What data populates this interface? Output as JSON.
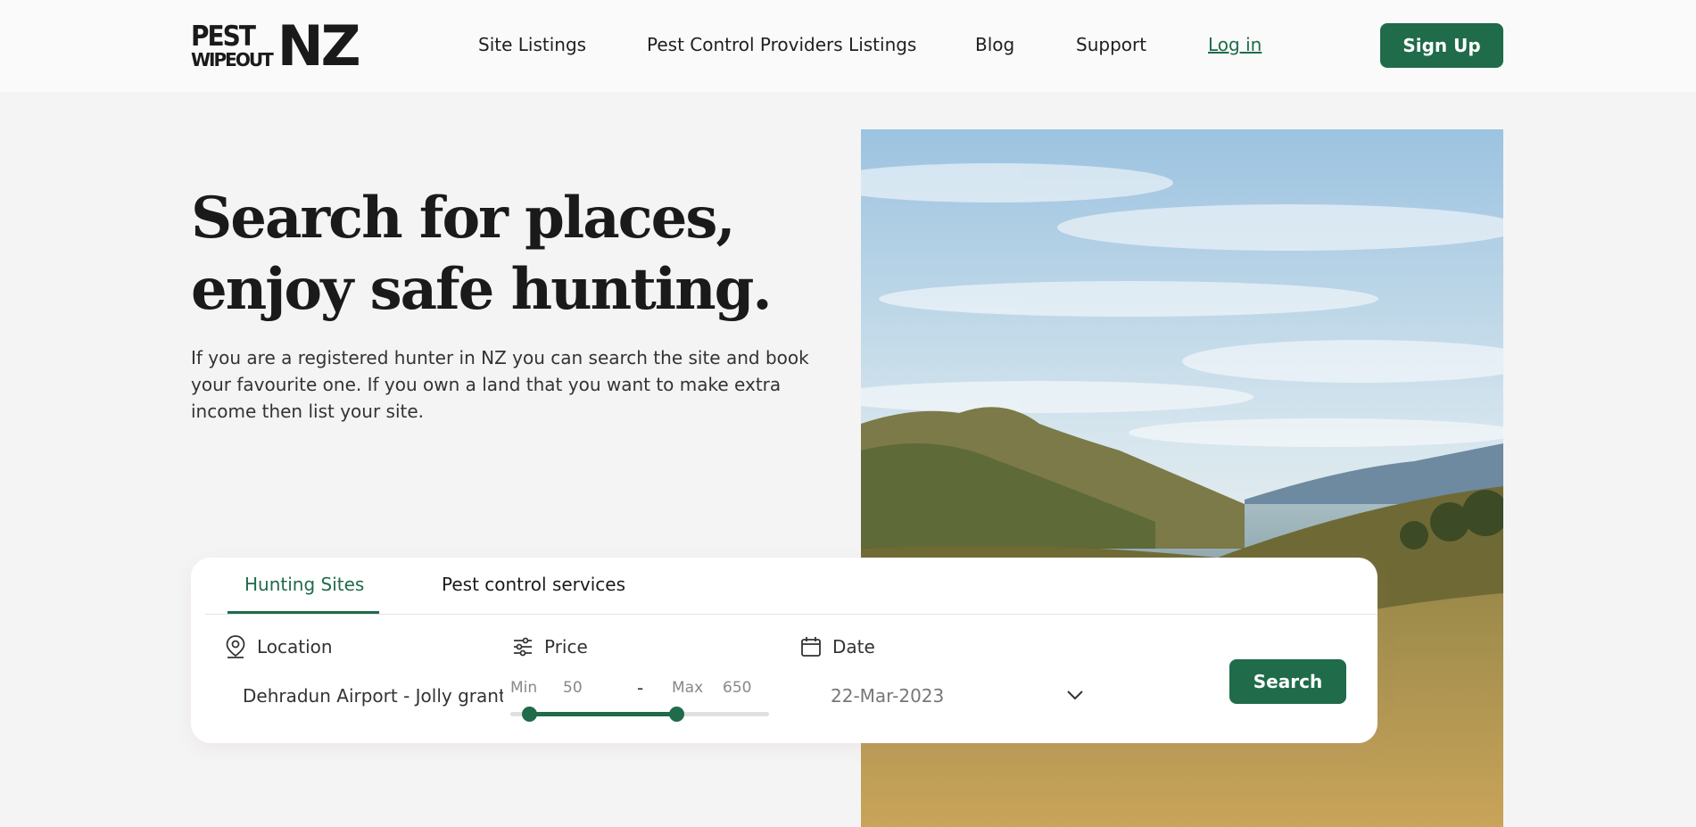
{
  "brand": {
    "logo_top": "PEST",
    "logo_bottom": "WIPEOUT",
    "logo_main": "NZ",
    "accent": "#1f6b4a"
  },
  "nav": {
    "items": [
      {
        "label": "Site Listings"
      },
      {
        "label": "Pest Control Providers Listings"
      },
      {
        "label": "Blog"
      },
      {
        "label": "Support"
      },
      {
        "label": "Log in"
      }
    ],
    "signup_label": "Sign Up"
  },
  "hero": {
    "title": "Search for places, enjoy safe hunting.",
    "description": "If you are a registered hunter in NZ you can search the site and book your favourite one. If you own a land that you want to make extra income then list your site."
  },
  "search": {
    "tabs": [
      {
        "label": "Hunting Sites",
        "active": true
      },
      {
        "label": "Pest control services",
        "active": false
      }
    ],
    "location": {
      "label": "Location",
      "icon": "map-pin-icon",
      "value": "Dehradun Airport - Jolly grant, Uttarakhand"
    },
    "price": {
      "label": "Price",
      "icon": "sliders-icon",
      "min_label": "Min",
      "min_value": "50",
      "separator": "-",
      "max_label": "Max",
      "max_value": "650",
      "range_min_fraction": 0.07,
      "range_max_fraction": 0.63
    },
    "date": {
      "label": "Date",
      "icon": "calendar-icon",
      "value": "22-Mar-2023",
      "dropdown_icon": "chevron-down-icon"
    },
    "button_label": "Search"
  }
}
